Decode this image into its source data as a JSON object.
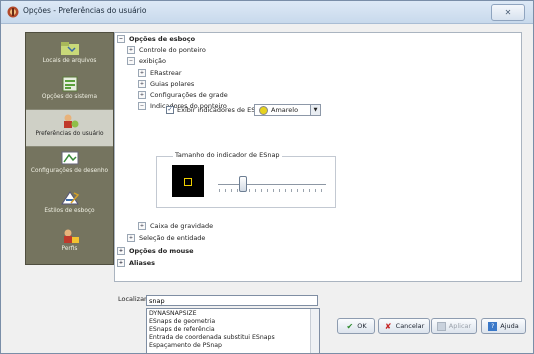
{
  "window": {
    "title": "Opções - Preferências do usuário"
  },
  "sidebar": {
    "items": [
      {
        "label": "Locais de arquivos"
      },
      {
        "label": "Opções do sistema"
      },
      {
        "label": "Preferências do usuário",
        "active": true
      },
      {
        "label": "Configurações de desenho"
      },
      {
        "label": "Estilos de esboço"
      },
      {
        "label": "Perfis"
      }
    ]
  },
  "tree": {
    "sketch_options": "Opções de esboço",
    "pointer_control": "Controle do ponteiro",
    "display": "exibição",
    "erastrear": "ERastrear",
    "polar_guides": "Guias polares",
    "grid_settings": "Configurações de grade",
    "pointer_indicators": "Indicadores do ponteiro",
    "show_esnap_indicators": "Exibir indicadores de ESnap",
    "color_value": "Amarelo",
    "indicator_size_group": "Tamanho do indicador de ESnap",
    "gravity_box": "Caixa de gravidade",
    "entity_selection": "Seleção de entidade",
    "mouse_options": "Opções do mouse",
    "aliases": "Aliases"
  },
  "find": {
    "label": "Localizar:",
    "value": "snap",
    "suggestions": [
      "DYNASNAPSIZE",
      "ESnaps de geometria",
      "ESnaps de referência",
      "Entrada de coordenada substitui ESnaps",
      "Espaçamento de PSnap"
    ]
  },
  "buttons": {
    "ok": "OK",
    "cancel": "Cancelar",
    "apply": "Aplicar",
    "help": "Ajuda"
  },
  "colors": {
    "sidebar_bg": "#75745f",
    "indicator_color": "#e6d21f"
  },
  "slider": {
    "position_fraction": 0.2
  }
}
